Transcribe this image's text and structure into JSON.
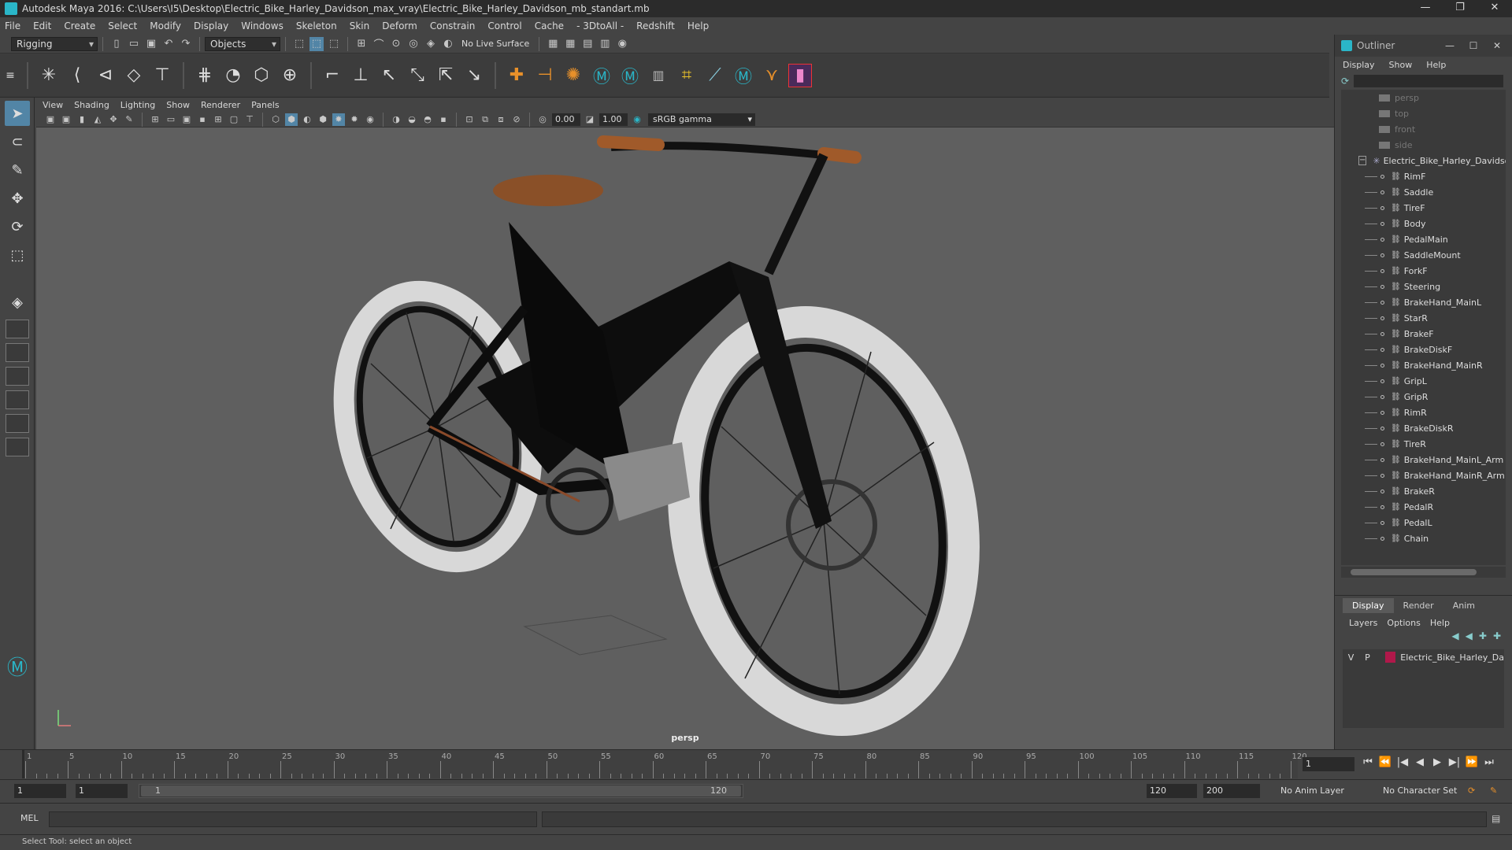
{
  "window": {
    "title": "Autodesk Maya 2016: C:\\Users\\I5\\Desktop\\Electric_Bike_Harley_Davidson_max_vray\\Electric_Bike_Harley_Davidson_mb_standart.mb",
    "minimize": "—",
    "maximize": "❐",
    "close": "✕"
  },
  "menubar": [
    "File",
    "Edit",
    "Create",
    "Select",
    "Modify",
    "Display",
    "Windows",
    "Skeleton",
    "Skin",
    "Deform",
    "Constrain",
    "Control",
    "Cache",
    "- 3DtoAll -",
    "Redshift",
    "Help"
  ],
  "status_line": {
    "mode": "Rigging",
    "selection_mask": "Objects",
    "live_surface": "No Live Surface"
  },
  "viewport": {
    "menu": [
      "View",
      "Shading",
      "Lighting",
      "Show",
      "Renderer",
      "Panels"
    ],
    "exposure": "0.00",
    "gamma_value": "1.00",
    "color_space": "sRGB gamma",
    "camera_label": "persp"
  },
  "outliner": {
    "title": "Outliner",
    "menu": [
      "Display",
      "Show",
      "Help"
    ],
    "cameras": [
      "persp",
      "top",
      "front",
      "side"
    ],
    "root": "Electric_Bike_Harley_Davidso",
    "children": [
      "RimF",
      "Saddle",
      "TireF",
      "Body",
      "PedalMain",
      "SaddleMount",
      "ForkF",
      "Steering",
      "BrakeHand_MainL",
      "StarR",
      "BrakeF",
      "BrakeDiskF",
      "BrakeHand_MainR",
      "GripL",
      "GripR",
      "RimR",
      "BrakeDiskR",
      "TireR",
      "BrakeHand_MainL_Arm",
      "BrakeHand_MainR_Arm",
      "BrakeR",
      "PedalR",
      "PedalL",
      "Chain"
    ]
  },
  "layer_editor": {
    "tabs": [
      "Display",
      "Render",
      "Anim"
    ],
    "menu": [
      "Layers",
      "Options",
      "Help"
    ],
    "layer": {
      "v": "V",
      "p": "P",
      "name": "Electric_Bike_Harley_Da",
      "color": "#b0184a"
    }
  },
  "timeline": {
    "tick_labels": [
      "1",
      "5",
      "10",
      "15",
      "20",
      "25",
      "30",
      "35",
      "40",
      "45",
      "50",
      "55",
      "60",
      "65",
      "70",
      "75",
      "80",
      "85",
      "90",
      "95",
      "100",
      "105",
      "110",
      "115",
      "120"
    ],
    "current_frame": "1"
  },
  "range": {
    "start": "1",
    "current": "1",
    "slider_start": "1",
    "slider_end": "120",
    "end": "120",
    "max": "200",
    "anim_layer": "No Anim Layer",
    "character_set": "No Character Set"
  },
  "command_line": {
    "label": "MEL"
  },
  "help_line": "Select Tool: select an object",
  "colors": {
    "accent": "#5285a6",
    "maya_teal": "#2ab6c8"
  }
}
